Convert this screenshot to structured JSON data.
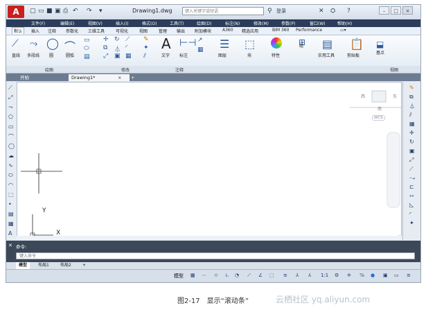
{
  "window": {
    "file_title": "Drawing1.dwg",
    "search_placeholder": "键入关键字或短语",
    "user_label": "登录",
    "logo": "A",
    "min": "–",
    "max": "□",
    "close": "×",
    "help": "?"
  },
  "menu": [
    "文件(F)",
    "编辑(E)",
    "视图(V)",
    "插入(I)",
    "格式(O)",
    "工具(T)",
    "绘图(D)",
    "标注(N)",
    "修改(M)",
    "参数(P)",
    "窗口(W)",
    "帮助(H)"
  ],
  "ribbon_tabs": [
    "默认",
    "插入",
    "注释",
    "参数化",
    "三维工具",
    "可视化",
    "视图",
    "管理",
    "输出",
    "附加模块",
    "A360",
    "精选应用",
    "BIM 360",
    "Performance"
  ],
  "ribbon_buttons": [
    "直线",
    "多段线",
    "圆",
    "圆弧",
    "文字",
    "标注",
    "图层",
    "块",
    "特性",
    "组",
    "实用工具",
    "剪贴板",
    "基点"
  ],
  "panel_labels": [
    "绘图",
    "修改",
    "注释",
    "视图"
  ],
  "doc_tabs": {
    "start": "开始",
    "drawing": "Drawing1*",
    "close": "×",
    "add": "+"
  },
  "viewcube": {
    "west": "西",
    "east": "东",
    "south": "南",
    "wcs": "WCS"
  },
  "ucs": {
    "x": "X",
    "y": "Y"
  },
  "command": {
    "label": "命令:",
    "placeholder": "键入命令"
  },
  "layouts": [
    "模型",
    "布局1",
    "布局2"
  ],
  "status": {
    "model": "模型",
    "scale": "1:1"
  },
  "caption": "图2-17　显示“滚动条”",
  "watermark": "云栖社区 yq.aliyun.com"
}
